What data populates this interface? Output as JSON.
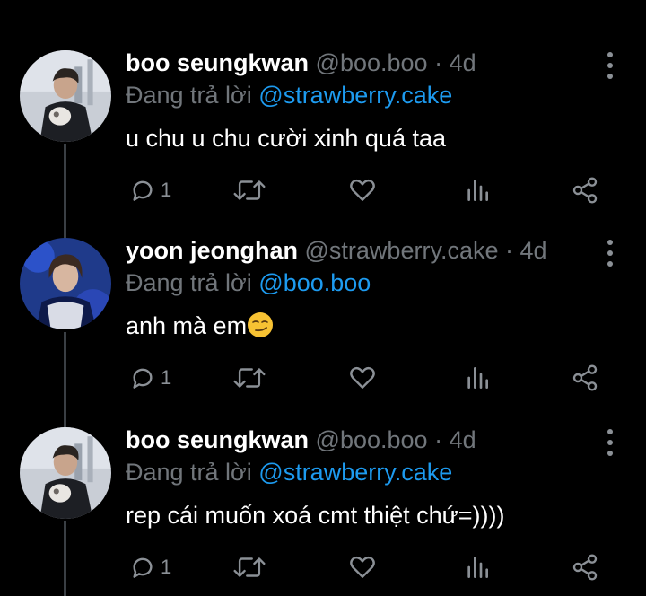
{
  "tweets": [
    {
      "name": "boo seungkwan",
      "handle": "@boo.boo",
      "time": "4d",
      "reply_prefix": "Đang trả lời",
      "reply_to": "@strawberry.cake",
      "text": "u chu u chu cười xinh quá taa",
      "reply_count": "1",
      "avatar_icon": "avatar-photo"
    },
    {
      "name": "yoon jeonghan",
      "handle": "@strawberry.cake",
      "time": "4d",
      "reply_prefix": "Đang trả lời",
      "reply_to": "@boo.boo",
      "text": "anh mà em",
      "emoji": "smirking-face",
      "reply_count": "1",
      "avatar_icon": "avatar-photo"
    },
    {
      "name": "boo seungkwan",
      "handle": "@boo.boo",
      "time": "4d",
      "reply_prefix": "Đang trả lời",
      "reply_to": "@strawberry.cake",
      "text": "rep cái muốn xoá cmt thiệt chứ=))))",
      "reply_count": "1",
      "avatar_icon": "avatar-photo"
    }
  ],
  "separator": "·",
  "colors": {
    "background": "#000000",
    "secondary_text": "#71767b",
    "mention": "#1d9bf0",
    "thread_line": "#3a3f44"
  }
}
